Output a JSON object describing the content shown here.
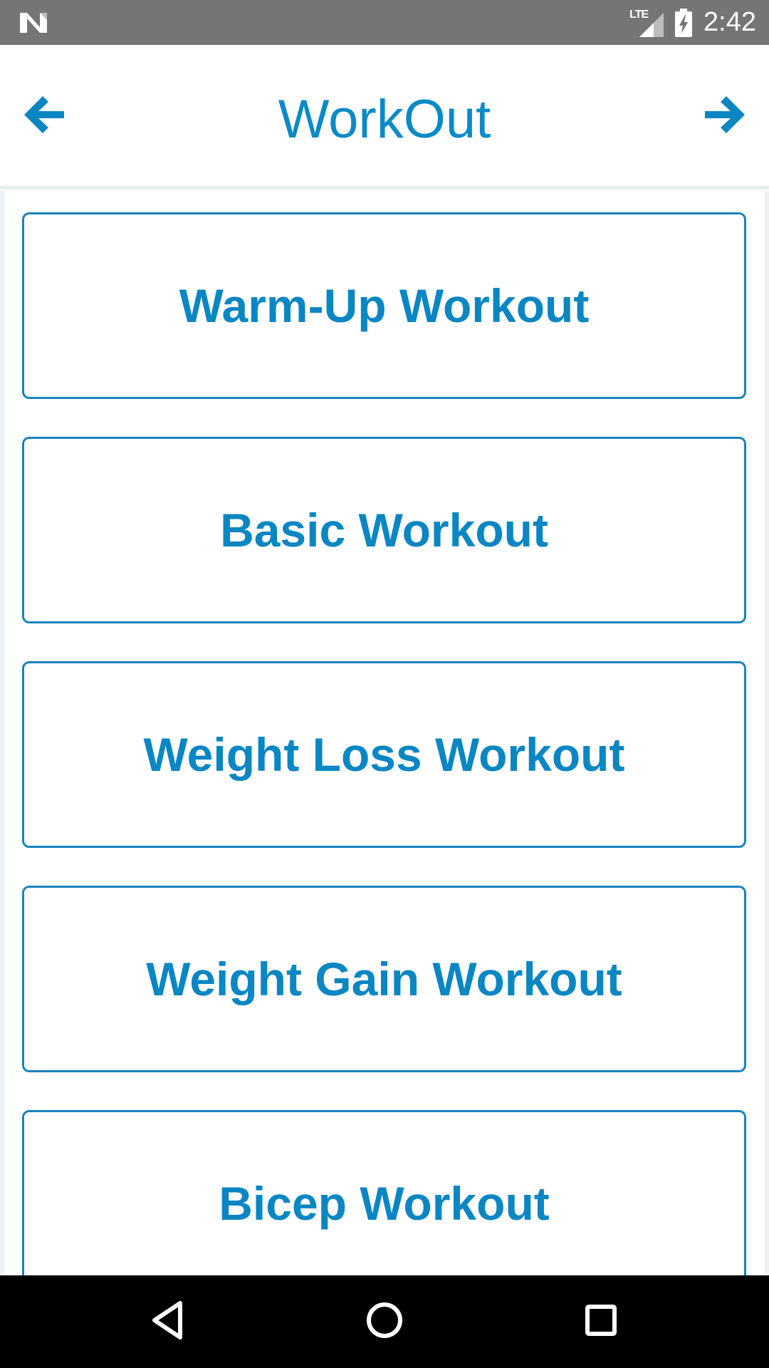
{
  "status_bar": {
    "network_label": "LTE",
    "time": "2:42"
  },
  "header": {
    "title": "WorkOut",
    "back_icon": "arrow-left-icon",
    "forward_icon": "arrow-right-icon"
  },
  "workouts": [
    {
      "label": "Warm-Up Workout"
    },
    {
      "label": "Basic Workout"
    },
    {
      "label": "Weight Loss Workout"
    },
    {
      "label": "Weight Gain Workout"
    },
    {
      "label": "Bicep Workout"
    }
  ],
  "colors": {
    "accent": "#0a86c3",
    "card_border": "#1b83bd",
    "status_bar": "#757575",
    "nav_bar": "#000000"
  },
  "nav_bar": {
    "back_icon": "triangle-back-icon",
    "home_icon": "circle-home-icon",
    "recents_icon": "square-recents-icon"
  }
}
